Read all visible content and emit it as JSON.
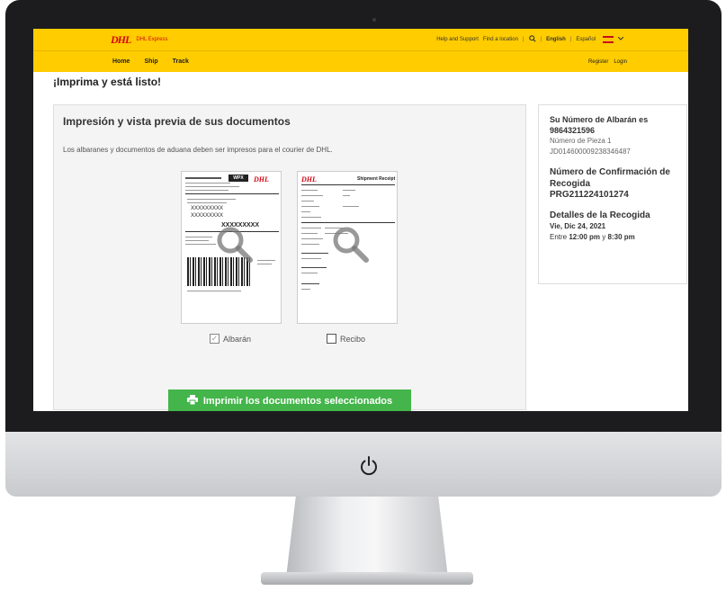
{
  "header": {
    "logo": "DHL",
    "logo_sub": "DHL Express",
    "help_link": "Help and Support",
    "find_location": "Find a location",
    "lang_en": "English",
    "lang_sep": "|",
    "lang_es": "Español",
    "divider": "|"
  },
  "nav": {
    "home": "Home",
    "ship": "Ship",
    "track": "Track",
    "register": "Register",
    "login": "Login"
  },
  "page": {
    "title": "¡Imprima y está listo!"
  },
  "documents": {
    "heading": "Impresión y vista previa de sus documentos",
    "description": "Los albaranes y documentos de aduana deben ser impresos para el courier de DHL.",
    "waybill_label": "Albarán",
    "waybill_checked": true,
    "receipt_label": "Recibo",
    "receipt_checked": false,
    "doc_code": "XXXXXXXXX",
    "doc_tag": "WPX",
    "receipt_title": "Shipment Receipt",
    "print_button": "Imprimir los documentos seleccionados"
  },
  "summary": {
    "waybill_title": "Su Número de Albarán es",
    "waybill_number": "9864321596",
    "piece_label": "Número de Pieza 1",
    "piece_number": "JD014600009238346487",
    "confirm_title": "Número de Confirmación de Recogida",
    "confirm_number": "PRG211224101274",
    "pickup_title": "Detalles de la Recogida",
    "pickup_date": "Vie, Dic 24, 2021",
    "pickup_between": "Entre",
    "pickup_start": "12:00 pm",
    "pickup_and": "y",
    "pickup_end": "8:30 pm"
  },
  "icons": {
    "search": "search-icon",
    "power": "power-icon",
    "printer": "printer-icon",
    "magnifier": "magnifier-icon",
    "chevron": "chevron-down-icon"
  },
  "colors": {
    "dhl_yellow": "#ffcc00",
    "dhl_red": "#d40511",
    "button_green": "#44b54a"
  }
}
